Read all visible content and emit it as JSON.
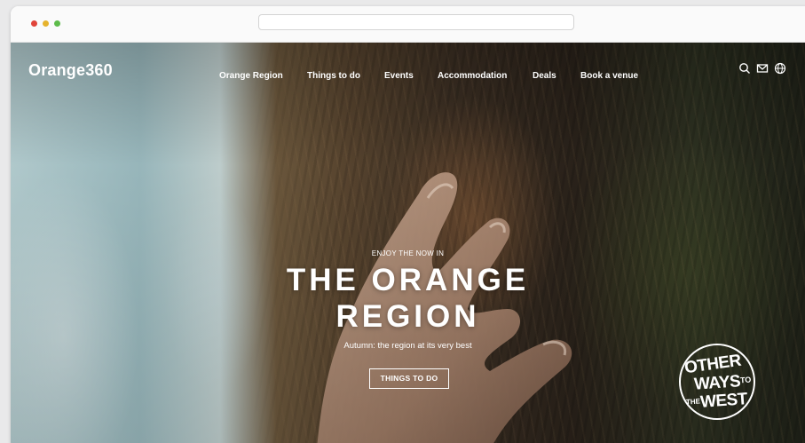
{
  "browser": {
    "traffic_lights": {
      "red": "#e0443a",
      "yellow": "#e6b32d",
      "green": "#5dbb4a"
    },
    "address_value": ""
  },
  "site": {
    "logo_text": "Orange360",
    "nav": [
      {
        "label": "Orange Region"
      },
      {
        "label": "Things to do"
      },
      {
        "label": "Events"
      },
      {
        "label": "Accommodation"
      },
      {
        "label": "Deals"
      },
      {
        "label": "Book a venue"
      }
    ],
    "icons": [
      "search-icon",
      "mail-icon",
      "globe-icon"
    ]
  },
  "hero": {
    "kicker": "ENJOY THE NOW IN",
    "title_line1": "THE ORANGE",
    "title_line2": "REGION",
    "subtitle": "Autumn: the region at its very best",
    "cta_label": "THINGS TO DO"
  },
  "badge": {
    "line1": "OTHER",
    "line2": "WAYS",
    "line2_small": "TO",
    "line3_small": "THE",
    "line3": "WEST"
  },
  "colors": {
    "text_on_hero": "#ffffff",
    "frame_bg": "#e9e9ea"
  }
}
